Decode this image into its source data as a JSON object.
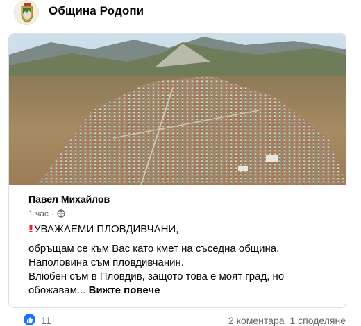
{
  "page": {
    "name": "Община Родопи"
  },
  "post": {
    "image_alt": "Aerial view of a town in a valley with mountains",
    "author": "Павел Михайлов",
    "time": "1 час",
    "separator": "·",
    "headline_icon": "double-exclamation-icon",
    "headline": "УВАЖАЕМИ ПЛОВДИВЧАНИ,",
    "lines": [
      "обръщам се към Вас като кмет на съседна община.",
      "Наполовина съм пловдивчанин.",
      "Влюбен съм в Пловдив, защото това е моят град, но",
      "обожавам..."
    ],
    "see_more": "Вижте повече"
  },
  "reactions": {
    "icon": "like-icon",
    "count": "11",
    "comments": "2 коментара",
    "shares": "1 споделяне"
  },
  "colors": {
    "accent": "#1877f2",
    "secondary_text": "#65676b",
    "border": "#dadde1",
    "exclaim": "#e41e3f"
  }
}
